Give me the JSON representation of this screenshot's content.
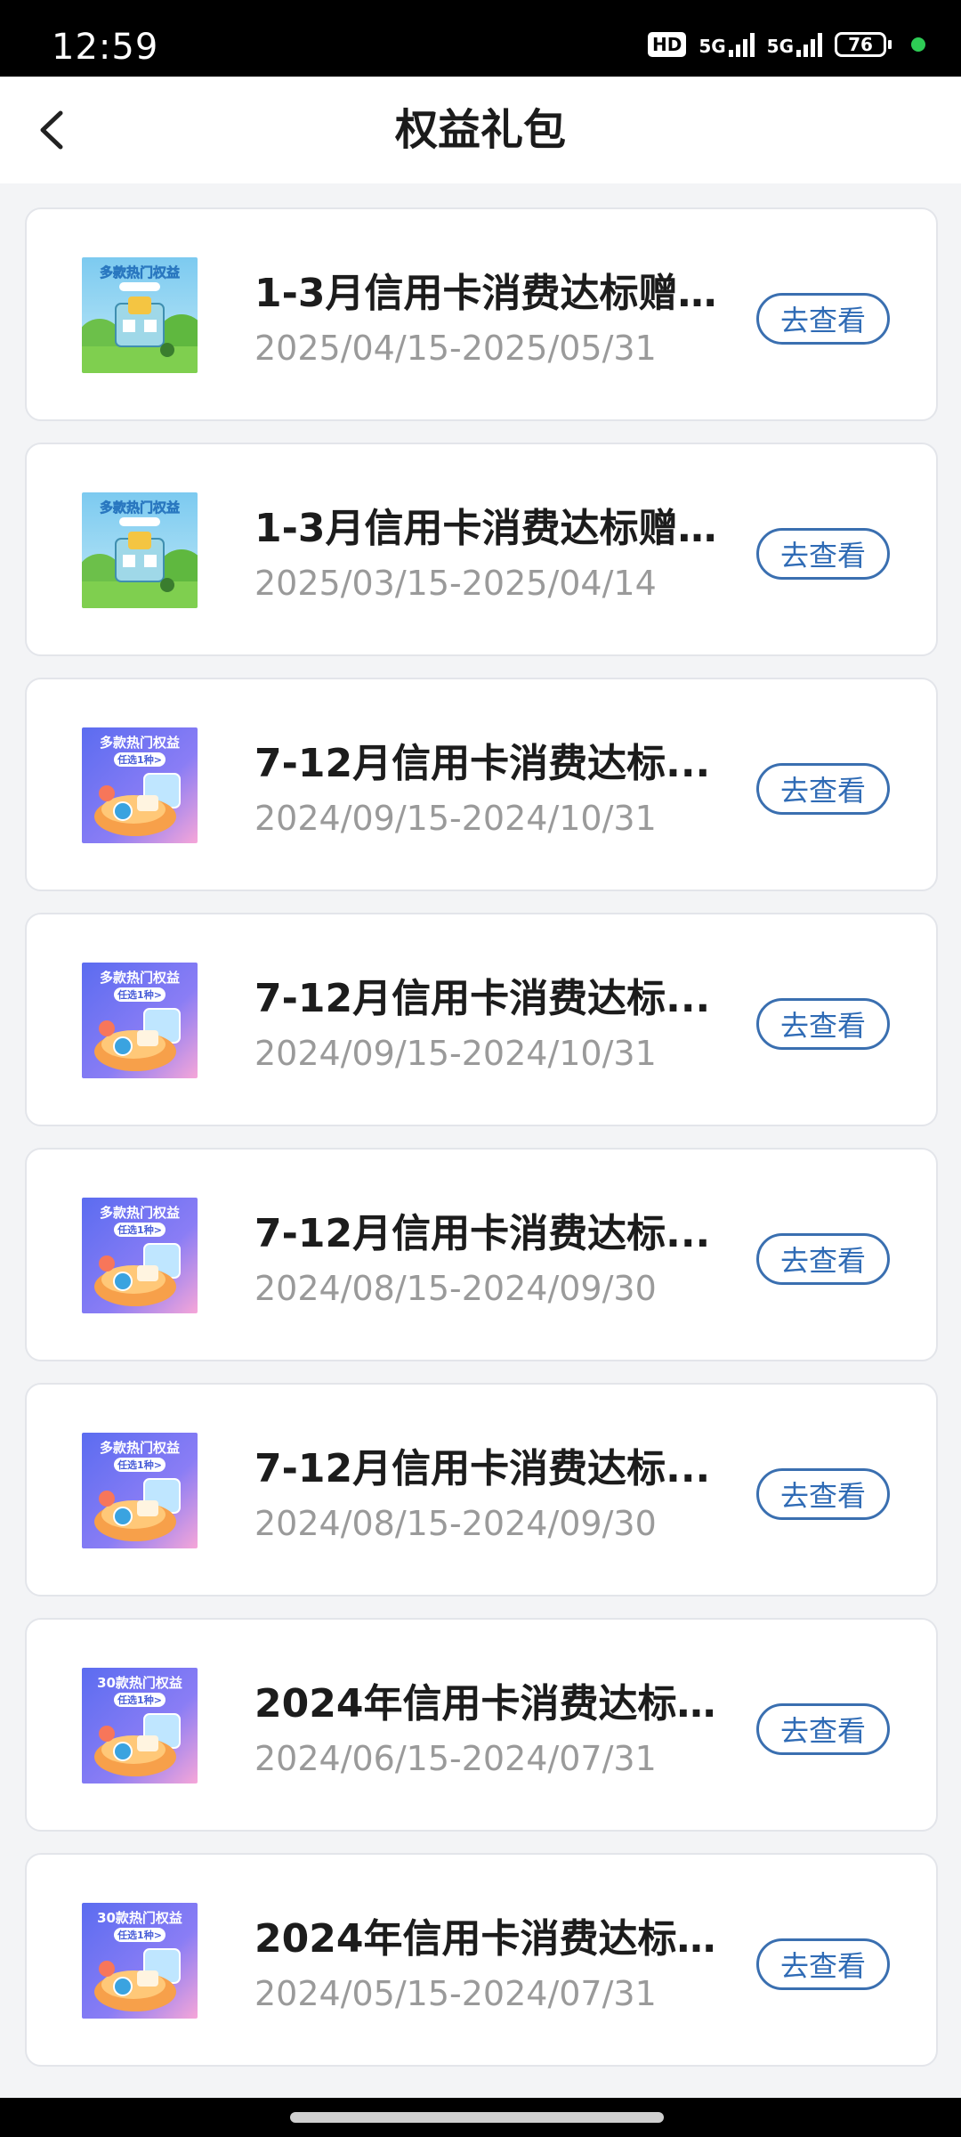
{
  "status_bar": {
    "time": "12:59",
    "hd": "HD",
    "net1": "5G",
    "net2": "5G",
    "battery": "76"
  },
  "header": {
    "title": "权益礼包"
  },
  "items": [
    {
      "title": "1-3月信用卡消费达标赠...",
      "date": "2025/04/15-2025/05/31",
      "button": "去查看",
      "thumb_label": "多款热门权益",
      "thumb_style": "green"
    },
    {
      "title": "1-3月信用卡消费达标赠...",
      "date": "2025/03/15-2025/04/14",
      "button": "去查看",
      "thumb_label": "多款热门权益",
      "thumb_style": "green"
    },
    {
      "title": "7-12月信用卡消费达标...",
      "date": "2024/09/15-2024/10/31",
      "button": "去查看",
      "thumb_label": "多款热门权益",
      "thumb_sub": "任选1种>",
      "thumb_style": "purple"
    },
    {
      "title": "7-12月信用卡消费达标...",
      "date": "2024/09/15-2024/10/31",
      "button": "去查看",
      "thumb_label": "多款热门权益",
      "thumb_sub": "任选1种>",
      "thumb_style": "purple"
    },
    {
      "title": "7-12月信用卡消费达标...",
      "date": "2024/08/15-2024/09/30",
      "button": "去查看",
      "thumb_label": "多款热门权益",
      "thumb_sub": "任选1种>",
      "thumb_style": "purple"
    },
    {
      "title": "7-12月信用卡消费达标...",
      "date": "2024/08/15-2024/09/30",
      "button": "去查看",
      "thumb_label": "多款热门权益",
      "thumb_sub": "任选1种>",
      "thumb_style": "purple"
    },
    {
      "title": "2024年信用卡消费达标...",
      "date": "2024/06/15-2024/07/31",
      "button": "去查看",
      "thumb_label": "30款热门权益",
      "thumb_sub": "任选1种>",
      "thumb_style": "purple"
    },
    {
      "title": "2024年信用卡消费达标...",
      "date": "2024/05/15-2024/07/31",
      "button": "去查看",
      "thumb_label": "30款热门权益",
      "thumb_sub": "任选1种>",
      "thumb_style": "purple"
    }
  ],
  "colors": {
    "accent": "#2f6bb5",
    "date_gray": "#9a9a9a",
    "background": "#f3f4f6"
  }
}
